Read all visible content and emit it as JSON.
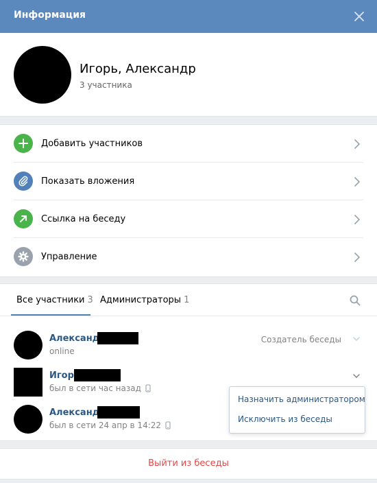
{
  "header": {
    "title": "Информация"
  },
  "conversation": {
    "name": "Игорь, Александр",
    "participants": "3 участника"
  },
  "actions": [
    {
      "label": "Добавить участников",
      "icon": "plus-icon",
      "color": "#4bb34b"
    },
    {
      "label": "Показать вложения",
      "icon": "paperclip-icon",
      "color": "#5181b8"
    },
    {
      "label": "Ссылка на беседу",
      "icon": "arrow-link-icon",
      "color": "#4bb34b"
    },
    {
      "label": "Управление",
      "icon": "gear-icon",
      "color": "#99a2ad"
    }
  ],
  "tabs": [
    {
      "label": "Все участники",
      "count": "3",
      "active": true
    },
    {
      "label": "Администраторы",
      "count": "1",
      "active": false
    }
  ],
  "members": [
    {
      "name": "Александр",
      "status": "online",
      "role": "Создатель беседы"
    },
    {
      "name": "Игорь",
      "status": "был в сети час назад"
    },
    {
      "name": "Александр",
      "status": "был в сети 24 апр в 14:22"
    }
  ],
  "member_menu": {
    "make_admin": "Назначить администратором",
    "remove": "Исключить из беседы"
  },
  "footer": {
    "leave": "Выйти из беседы"
  },
  "colors": {
    "header": "#5b88bd",
    "link": "#2a5885",
    "danger": "#e64646",
    "accent": "#5181b8"
  }
}
